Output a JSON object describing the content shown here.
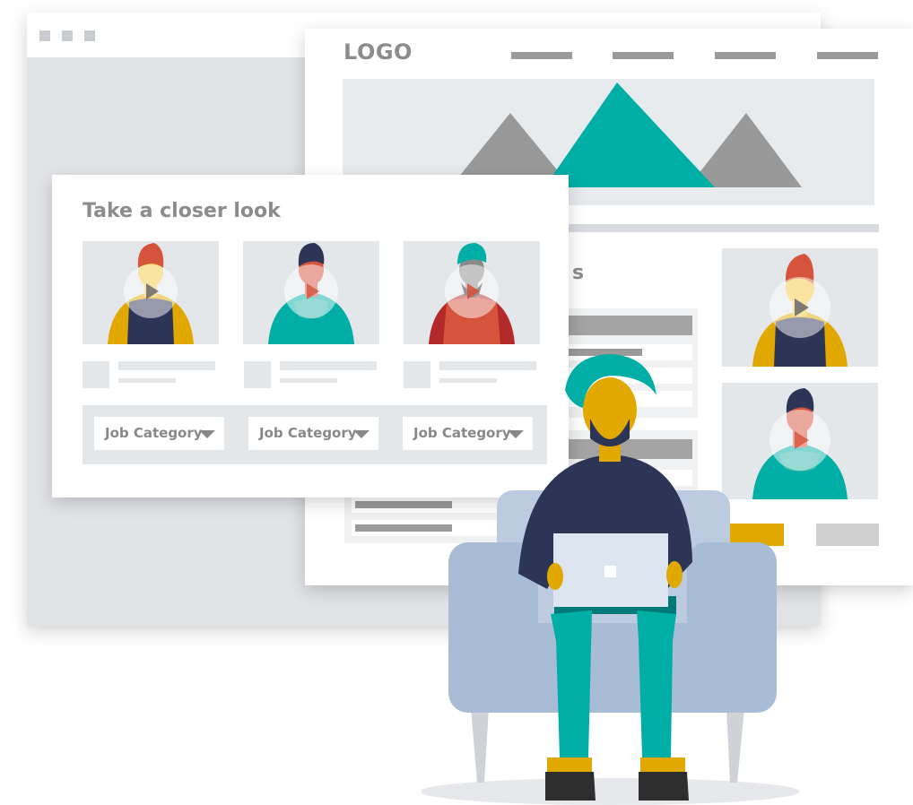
{
  "logo": "LOGO",
  "card": {
    "title": "Take a closer look",
    "dropdowns": [
      {
        "label": "Job Category"
      },
      {
        "label": "Job Category"
      },
      {
        "label": "Job Category"
      }
    ]
  },
  "partial_heading": "s",
  "colors": {
    "teal": "#00aea6",
    "navy": "#2d3556",
    "mustard": "#e0a800",
    "red_orange": "#d6533c",
    "armchair": "#a9bcd6",
    "panel_grey": "#e3e7ea"
  },
  "icons": [
    "window-dot-icon",
    "mountain-image-icon",
    "person-avatar-icon",
    "chevron-down-icon",
    "laptop-icon"
  ]
}
